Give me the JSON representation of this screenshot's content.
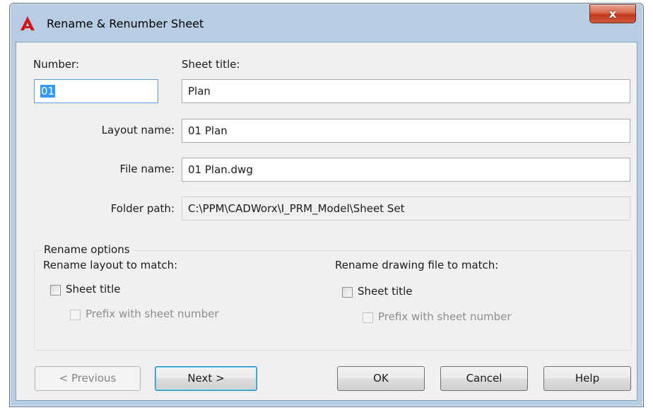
{
  "window": {
    "title": "Rename & Renumber Sheet",
    "close_glyph": "x",
    "icon": "autocad-logo-icon"
  },
  "fields": {
    "number_label": "Number:",
    "number_value": "01",
    "sheet_title_label": "Sheet title:",
    "sheet_title_value": "Plan",
    "layout_name_label": "Layout name:",
    "layout_name_value": "01 Plan",
    "file_name_label": "File name:",
    "file_name_value": "01 Plan.dwg",
    "folder_path_label": "Folder path:",
    "folder_path_value": "C:\\PPM\\CADWorx\\I_PRM_Model\\Sheet Set"
  },
  "rename_options": {
    "group_label": "Rename options",
    "layout": {
      "heading": "Rename layout to match:",
      "sheet_title_label": "Sheet title",
      "sheet_title_checked": false,
      "prefix_label": "Prefix with sheet number",
      "prefix_checked": false,
      "prefix_enabled": false
    },
    "drawing": {
      "heading": "Rename drawing file to match:",
      "sheet_title_label": "Sheet title",
      "sheet_title_checked": false,
      "prefix_label": "Prefix with sheet number",
      "prefix_checked": false,
      "prefix_enabled": false
    }
  },
  "buttons": {
    "previous": "< Previous",
    "next": "Next >",
    "ok": "OK",
    "cancel": "Cancel",
    "help": "Help"
  },
  "colors": {
    "title_bar": "#b6cde3",
    "close": "#c7462a",
    "selection": "#3399ff",
    "logo": "#d0161b"
  }
}
